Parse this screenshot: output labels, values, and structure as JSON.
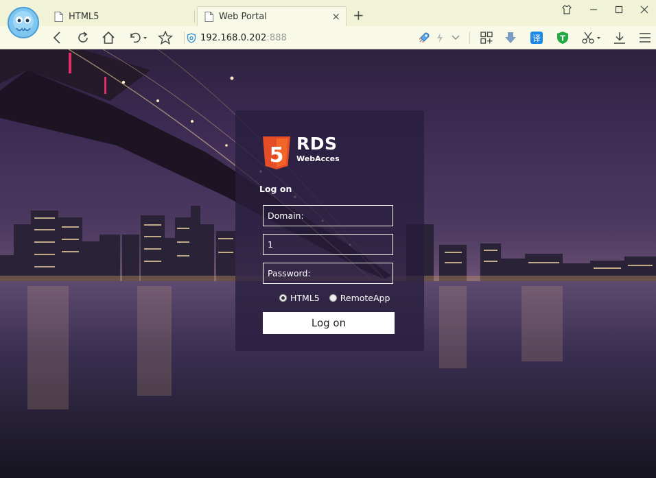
{
  "browser": {
    "tabs": [
      {
        "title": "HTML5",
        "active": false
      },
      {
        "title": "Web Portal",
        "active": true
      }
    ],
    "tab_close_glyph": "×",
    "new_tab_glyph": "+",
    "url_host": "192.168.0.202",
    "url_port": ":888",
    "icons": [
      "back-icon",
      "reload-icon",
      "home-icon",
      "undo-icon",
      "star-icon",
      "shield-icon",
      "rocket-icon",
      "lightning-icon",
      "chevron-down-icon",
      "apps-icon",
      "download-arrow-icon",
      "translate-icon",
      "security-icon",
      "scissors-icon",
      "download-icon",
      "menu-icon"
    ],
    "translate_glyph": "译",
    "security_glyph": "T"
  },
  "colors": {
    "chrome_bg": "#f1f3d7",
    "html5_orange": "#e44d26",
    "html5_light": "#f16529",
    "translate_blue": "#1e88e5",
    "security_green": "#22aa44"
  },
  "login": {
    "logo_glyph": "5",
    "brand": "RDS",
    "brand_sub": "WebAcces",
    "title": "Log on",
    "domain_placeholder": "Domain:",
    "username_value": "1",
    "password_placeholder": "Password:",
    "options": [
      {
        "label": "HTML5",
        "selected": true
      },
      {
        "label": "RemoteApp",
        "selected": false
      }
    ],
    "submit_label": "Log on"
  }
}
